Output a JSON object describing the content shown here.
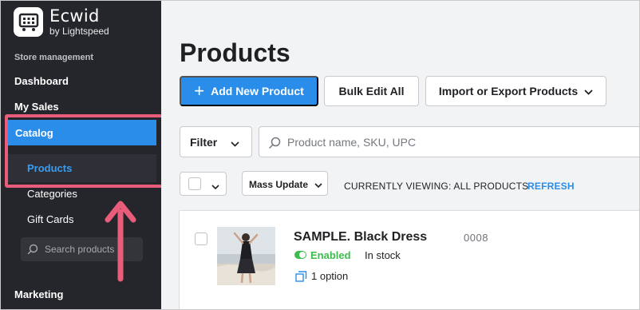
{
  "brand": {
    "title": "Ecwid",
    "subtitle": "by Lightspeed"
  },
  "sidebar": {
    "section_label": "Store management",
    "items": {
      "dashboard": "Dashboard",
      "my_sales": "My Sales",
      "catalog": "Catalog",
      "products": "Products",
      "categories": "Categories",
      "gift_cards": "Gift Cards",
      "marketing": "Marketing"
    },
    "search_placeholder": "Search products"
  },
  "main": {
    "title": "Products",
    "buttons": {
      "add_new": "Add New Product",
      "bulk_edit": "Bulk Edit All",
      "import_export": "Import or Export Products"
    },
    "filter_label": "Filter",
    "search_placeholder": "Product name, SKU, UPC",
    "mass_update": "Mass Update",
    "viewing_text": "CURRENTLY VIEWING: ALL PRODUCTS",
    "refresh": "REFRESH",
    "product": {
      "name": "SAMPLE. Black Dress",
      "sku": "0008",
      "status": "Enabled",
      "stock": "In stock",
      "options": "1 option"
    }
  },
  "colors": {
    "accent": "#2a8de9",
    "sidebar_bg": "#25262b",
    "highlight": "#e95d7b",
    "enabled": "#3cbd4a"
  }
}
